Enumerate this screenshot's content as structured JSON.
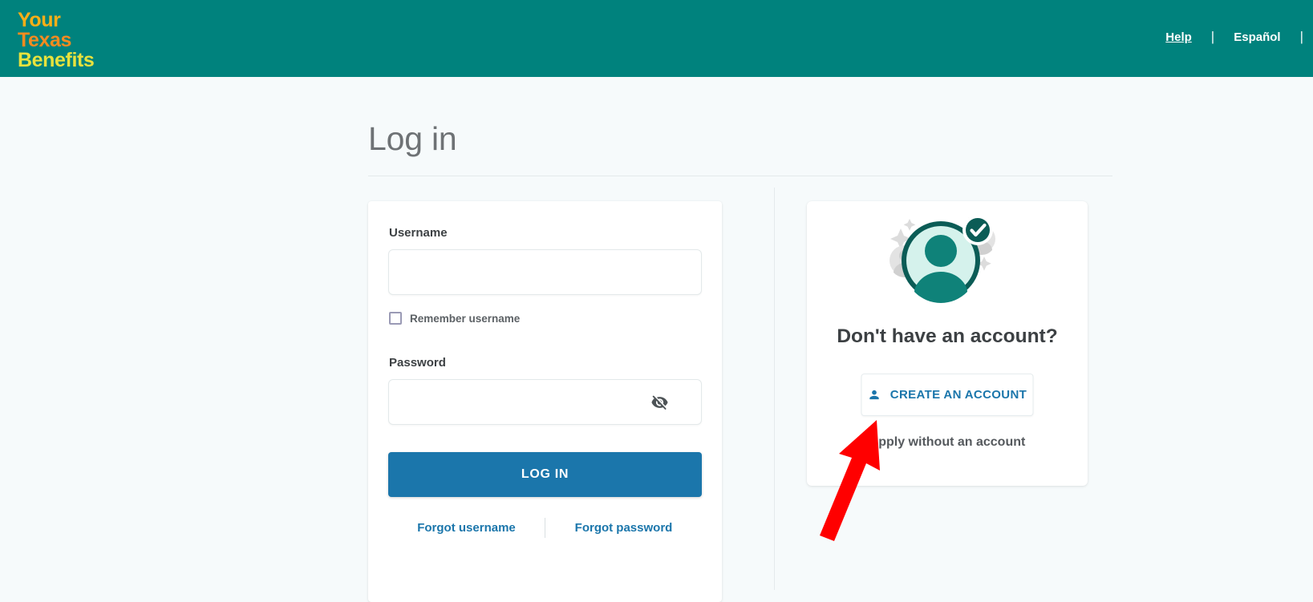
{
  "header": {
    "logo": {
      "line1": "Your",
      "line2": "Texas",
      "line3": "Benefits"
    },
    "nav": {
      "help": "Help",
      "espanol": "Español",
      "separator": "|"
    },
    "background_color": "#00827d"
  },
  "page": {
    "title": "Log in",
    "background_color": "#f6fafb"
  },
  "login_form": {
    "username_label": "Username",
    "username_value": "",
    "username_placeholder": "",
    "remember_label": "Remember username",
    "remember_checked": false,
    "password_label": "Password",
    "password_value": "",
    "password_placeholder": "",
    "toggle_password_icon": "eye-slash-icon",
    "submit_label": "LOG IN",
    "submit_color": "#1b76ab",
    "forgot_username_label": "Forgot username",
    "forgot_password_label": "Forgot password",
    "link_color": "#1b76ab"
  },
  "create_account": {
    "illustration_icon": "verified-account-avatar-illustration",
    "heading": "Don't have an account?",
    "create_button_label": "CREATE AN ACCOUNT",
    "create_button_icon": "person-icon",
    "apply_link_label": "Apply without an account",
    "accent_color": "#1b76ab",
    "illustration_colors": {
      "avatar_fill": "#d5f2ec",
      "avatar_ring": "#0b5c56",
      "person": "#0f8279",
      "badge": "#0b5c56",
      "sparkle": "#dcdcdc"
    }
  },
  "annotation": {
    "arrow_color": "#ff0000",
    "arrow_points_to": "create-an-account-button"
  }
}
